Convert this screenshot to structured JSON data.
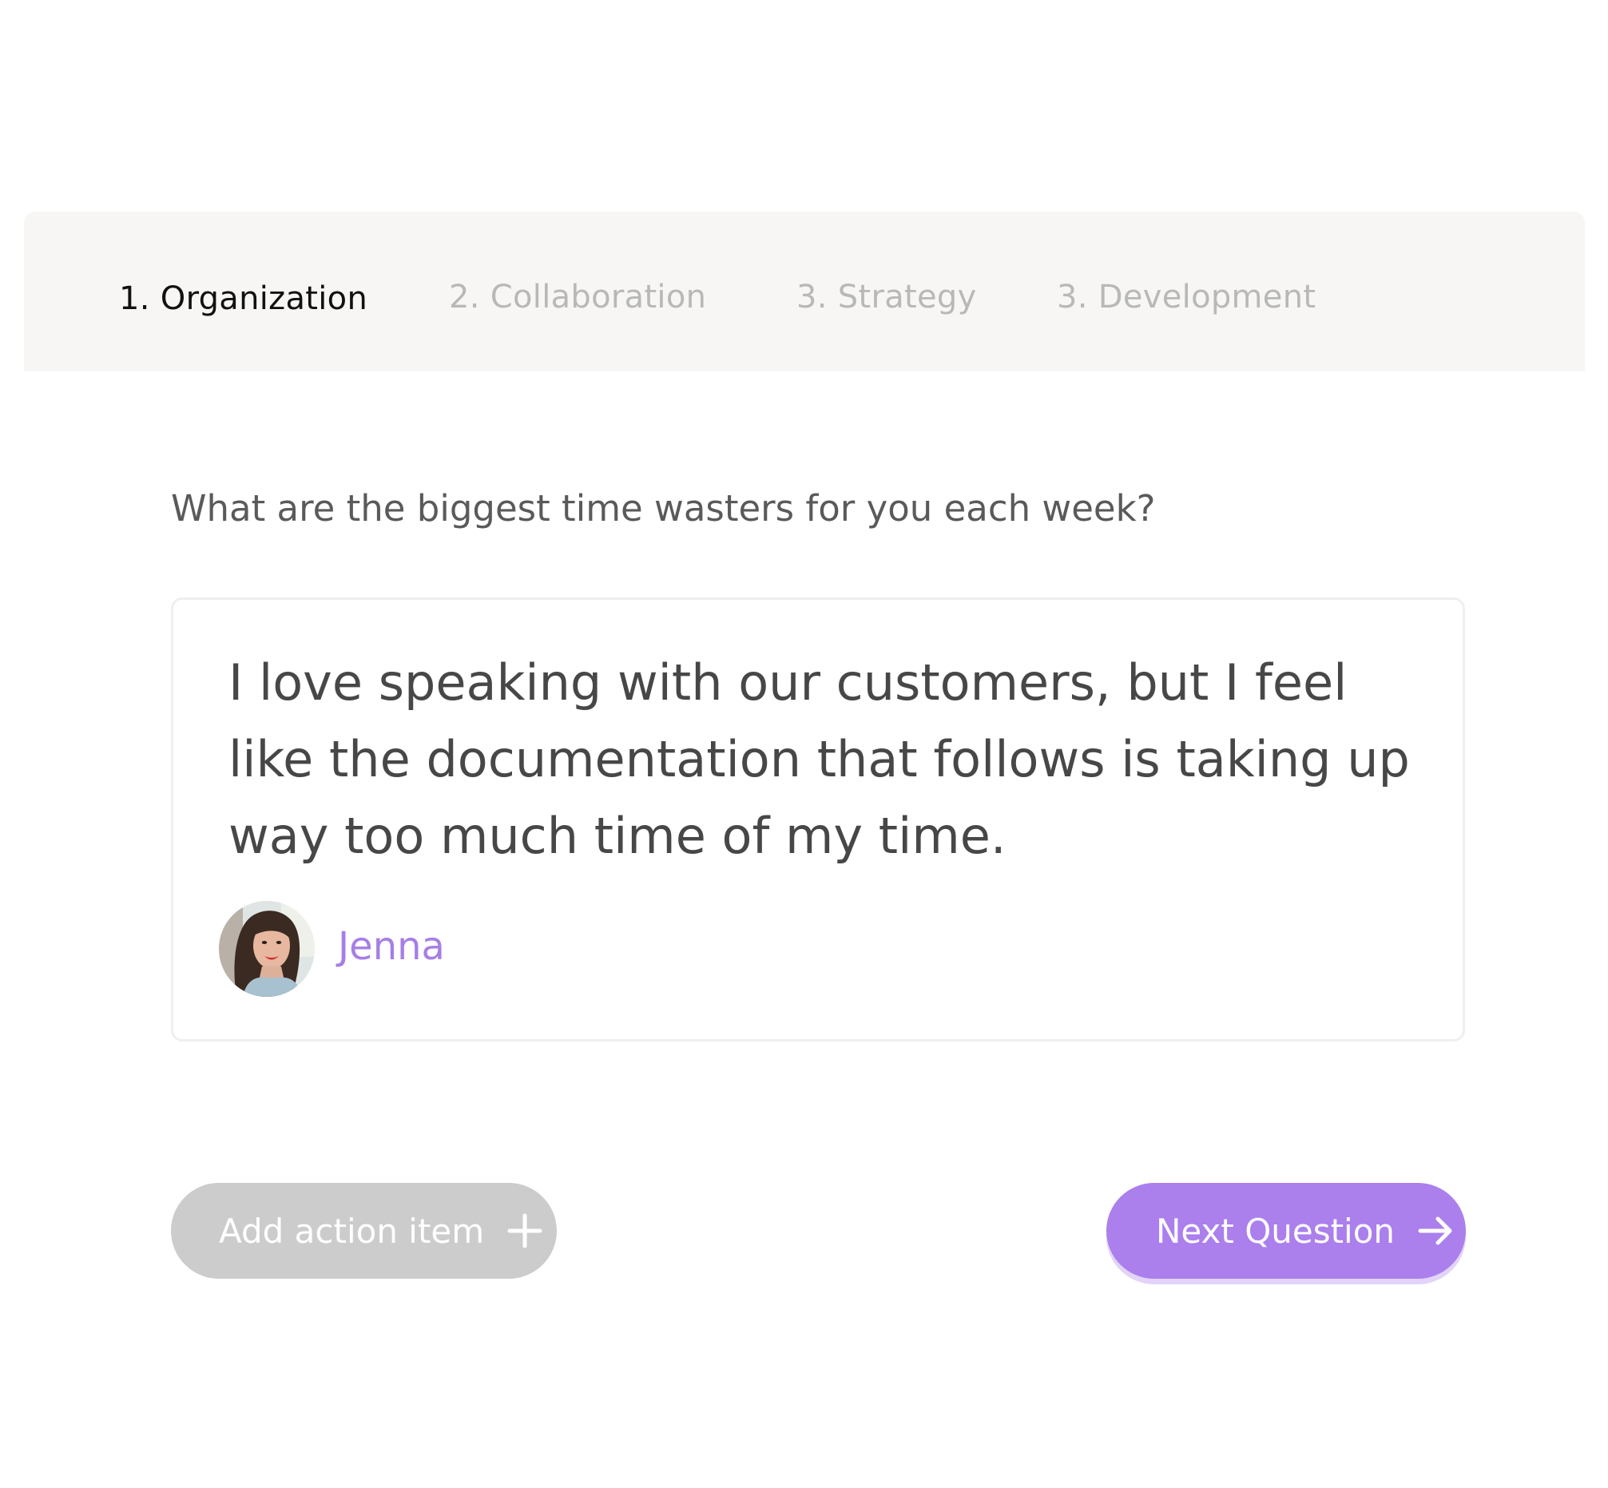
{
  "tabs": [
    {
      "label": "1. Organization",
      "active": true
    },
    {
      "label": "2. Collaboration",
      "active": false
    },
    {
      "label": "3. Strategy",
      "active": false
    },
    {
      "label": "3. Development",
      "active": false
    }
  ],
  "question": {
    "text": "What are the biggest time wasters for you each week?"
  },
  "answer": {
    "text": "I love speaking with our customers, but I feel like the documentation that follows is taking up way too much time of my time.",
    "author": "Jenna"
  },
  "actions": {
    "add_label": "Add action item",
    "add_icon": "plus-icon",
    "next_label": "Next Question",
    "next_icon": "arrow-right-icon"
  },
  "colors": {
    "accent": "#ab7fec",
    "author_name": "#a77ee6",
    "disabled_button": "#cccccc",
    "tabbar_bg": "#f7f6f4",
    "active_tab": "#111111",
    "inactive_tab": "#b8b8b8"
  }
}
